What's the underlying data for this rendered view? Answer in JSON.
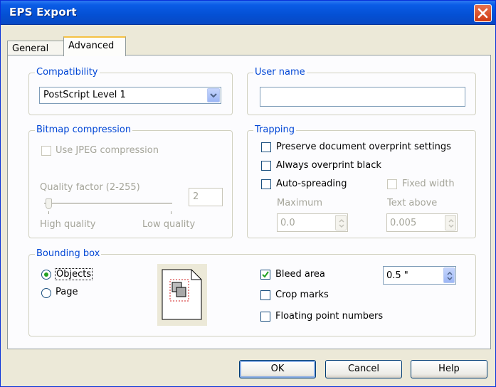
{
  "window": {
    "title": "EPS Export"
  },
  "tabs": [
    {
      "label": "General"
    },
    {
      "label": "Advanced"
    }
  ],
  "compatibility": {
    "group_label": "Compatibility",
    "selected": "PostScript Level 1"
  },
  "user_name": {
    "group_label": "User name",
    "value": ""
  },
  "bitmap_compression": {
    "group_label": "Bitmap compression",
    "use_jpeg_label": "Use JPEG compression",
    "quality_label": "Quality factor (2-255)",
    "quality_value": "2",
    "high_quality_label": "High quality",
    "low_quality_label": "Low quality"
  },
  "trapping": {
    "group_label": "Trapping",
    "preserve_label": "Preserve document overprint settings",
    "always_overprint_label": "Always overprint black",
    "auto_spreading_label": "Auto-spreading",
    "fixed_width_label": "Fixed width",
    "maximum_label": "Maximum",
    "maximum_value": "0.0",
    "text_above_label": "Text above",
    "text_above_value": "0.005"
  },
  "bounding_box": {
    "group_label": "Bounding box",
    "objects_label": "Objects",
    "page_label": "Page",
    "bleed_area_label": "Bleed area",
    "bleed_value": "0.5 \"",
    "crop_marks_label": "Crop marks",
    "floating_point_label": "Floating point numbers"
  },
  "buttons": {
    "ok": "OK",
    "cancel": "Cancel",
    "help": "Help"
  }
}
